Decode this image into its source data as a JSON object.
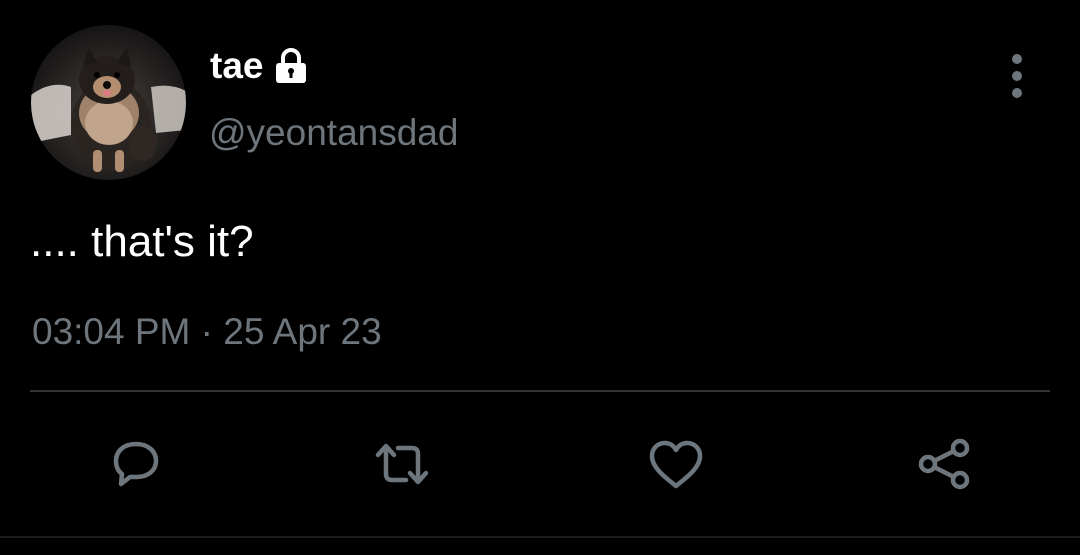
{
  "tweet": {
    "display_name": "tae",
    "handle": "@yeontansdad",
    "text": ".... that's it?",
    "timestamp": "03:04 PM · 25 Apr 23",
    "protected": true
  },
  "icons": {
    "lock": "lock-icon",
    "more": "more-vertical-icon",
    "reply": "reply-icon",
    "retweet": "retweet-icon",
    "like": "like-icon",
    "share": "share-icon"
  },
  "colors": {
    "background": "#000000",
    "primary_text": "#ffffff",
    "secondary_text": "#6e767d",
    "divider": "#2f3336"
  }
}
